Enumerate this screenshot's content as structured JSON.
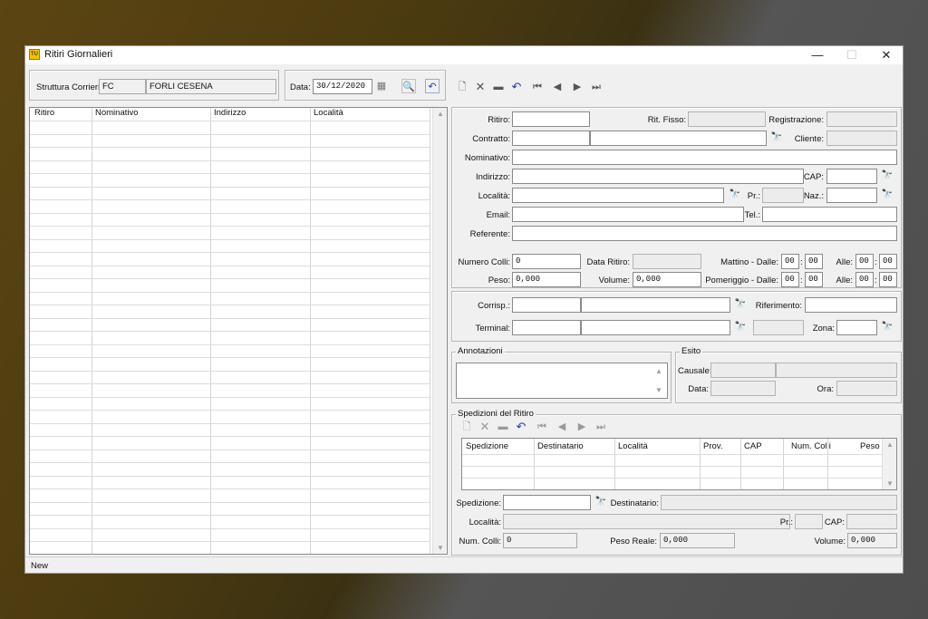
{
  "window": {
    "title": "Ritiri Giornalieri",
    "icon_text": "TU",
    "minimize": "—",
    "maximize": "☐",
    "close": "✕"
  },
  "filter": {
    "struttura_label": "Struttura Corrieri:",
    "struttura_code": "FC",
    "struttura_name": "FORLI CESENA",
    "data_label": "Data:",
    "data_value": "30/12/2020"
  },
  "left_grid": {
    "columns": [
      "Ritiro",
      "Nominativo",
      "Indirizzo",
      "Località"
    ]
  },
  "form": {
    "ritiro": "Ritiro:",
    "rit_fisso": "Rit. Fisso:",
    "registrazione": "Registrazione:",
    "contratto": "Contratto:",
    "cliente": "Cliente:",
    "nominativo": "Nominativo:",
    "indirizzo": "Indirizzo:",
    "cap": "CAP:",
    "localita": "Località:",
    "pr": "Pr.:",
    "naz": "Naz.:",
    "email": "Email:",
    "tel": "Tel.:",
    "referente": "Referente:",
    "numero_colli": "Numero Colli:",
    "numero_colli_value": "0",
    "data_ritiro": "Data Ritiro:",
    "mattino": "Mattino - Dalle:",
    "alle": "Alle:",
    "peso": "Peso:",
    "peso_value": "0,000",
    "volume": "Volume:",
    "volume_value": "0,000",
    "pomeriggio": "Pomeriggio - Dalle:",
    "time_value": "00",
    "time_sep": ":",
    "corrisp": "Corrisp.:",
    "riferimento": "Riferimento:",
    "terminal": "Terminal:",
    "zona": "Zona:"
  },
  "annotazioni": {
    "title": "Annotazioni"
  },
  "esito": {
    "title": "Esito",
    "causale": "Causale:",
    "data": "Data:",
    "ora": "Ora:"
  },
  "spedizioni": {
    "title": "Spedizioni del Ritiro",
    "columns": [
      "Spedizione",
      "Destinatario",
      "Località",
      "Prov.",
      "CAP",
      "Num. Colli",
      "Peso"
    ],
    "spedizione": "Spedizione:",
    "destinatario": "Destinatario:",
    "localita": "Località:",
    "pr": "Pr.:",
    "cap": "CAP:",
    "num_colli": "Num. Colli:",
    "num_colli_value": "0",
    "peso_reale": "Peso Reale:",
    "peso_reale_value": "0,000",
    "volume": "Volume:",
    "volume_value": "0,000"
  },
  "icons": {
    "new": "🗋",
    "delete": "✕",
    "save": "▬",
    "undo": "↶",
    "first": "⏮",
    "prev": "◀",
    "next": "▶",
    "last": "⏭",
    "binoculars": "🔭",
    "search": "🔍",
    "calendar": "▦"
  },
  "status": {
    "text": "New"
  },
  "colors": {
    "accent": "#1f3fb0",
    "icon_yellow": "#f2c200"
  }
}
